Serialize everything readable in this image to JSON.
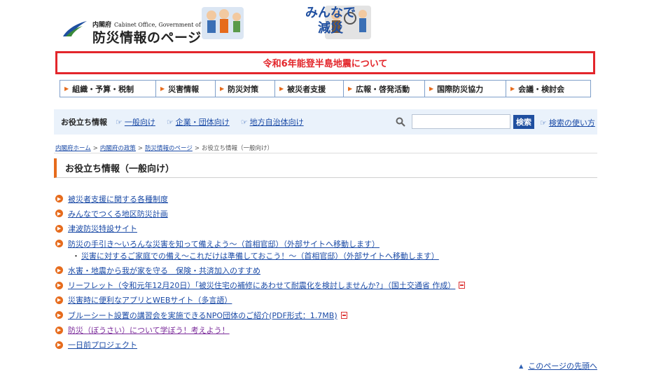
{
  "header": {
    "office_ja": "内閣府",
    "office_en": "Cabinet Office, Government of Japan",
    "site_title": "防災情報のページ",
    "banner_line1": "みんなで",
    "banner_line2": "減災"
  },
  "alert": {
    "text": "令和6年能登半島地震について",
    "color": "#e3262b"
  },
  "global_nav": [
    {
      "label": "組織・予算・税制"
    },
    {
      "label": "災害情報"
    },
    {
      "label": "防災対策"
    },
    {
      "label": "被災者支援"
    },
    {
      "label": "広報・啓発活動"
    },
    {
      "label": "国際防災協力"
    },
    {
      "label": "会議・検討会"
    }
  ],
  "utility_bar": {
    "label": "お役立ち情報",
    "links": [
      {
        "label": "一般向け"
      },
      {
        "label": "企業・団体向け"
      },
      {
        "label": "地方自治体向け"
      }
    ],
    "search_value": "",
    "search_button": "検索",
    "help_link": "検索の使い方"
  },
  "breadcrumb": {
    "items": [
      "内閣府ホーム",
      "内閣府の政策",
      "防災情報のページ"
    ],
    "current": "お役立ち情報（一般向け）",
    "separator": ">"
  },
  "page_title": "お役立ち情報（一般向け）",
  "links": [
    {
      "label": "被災者支援に関する各種制度"
    },
    {
      "label": "みんなでつくる地区防災計画"
    },
    {
      "label": "津波防災特設サイト"
    },
    {
      "label": "防災の手引き～いろんな災害を知って備えよう～（首相官邸）（外部サイトへ移動します）"
    },
    {
      "label": "災害に対するご家庭での備え～これだけは準備しておこう！～（首相官邸）（外部サイトへ移動します）"
    },
    {
      "label": "水害・地震から我が家を守る　保険・共済加入のすすめ"
    },
    {
      "label": "リーフレット（令和元年12月20日）「被災住宅の補修にあわせて耐震化を検討しませんか?」（国土交通省 作成）"
    },
    {
      "label": "災害時に便利なアプリとWEBサイト（多言語）"
    },
    {
      "label": "ブルーシート設置の講習会を実施できるNPO団体のご紹介(PDF形式：1.7MB)"
    },
    {
      "label": "防災（ぼうさい）について学ぼう！考えよう！"
    },
    {
      "label": "一日前プロジェクト"
    }
  ],
  "page_top": "このページの先頭へ",
  "colors": {
    "accent": "#e66b1c",
    "link": "#1a4aa6",
    "nav_border": "#7f9fca",
    "button": "#1f4fa0"
  }
}
